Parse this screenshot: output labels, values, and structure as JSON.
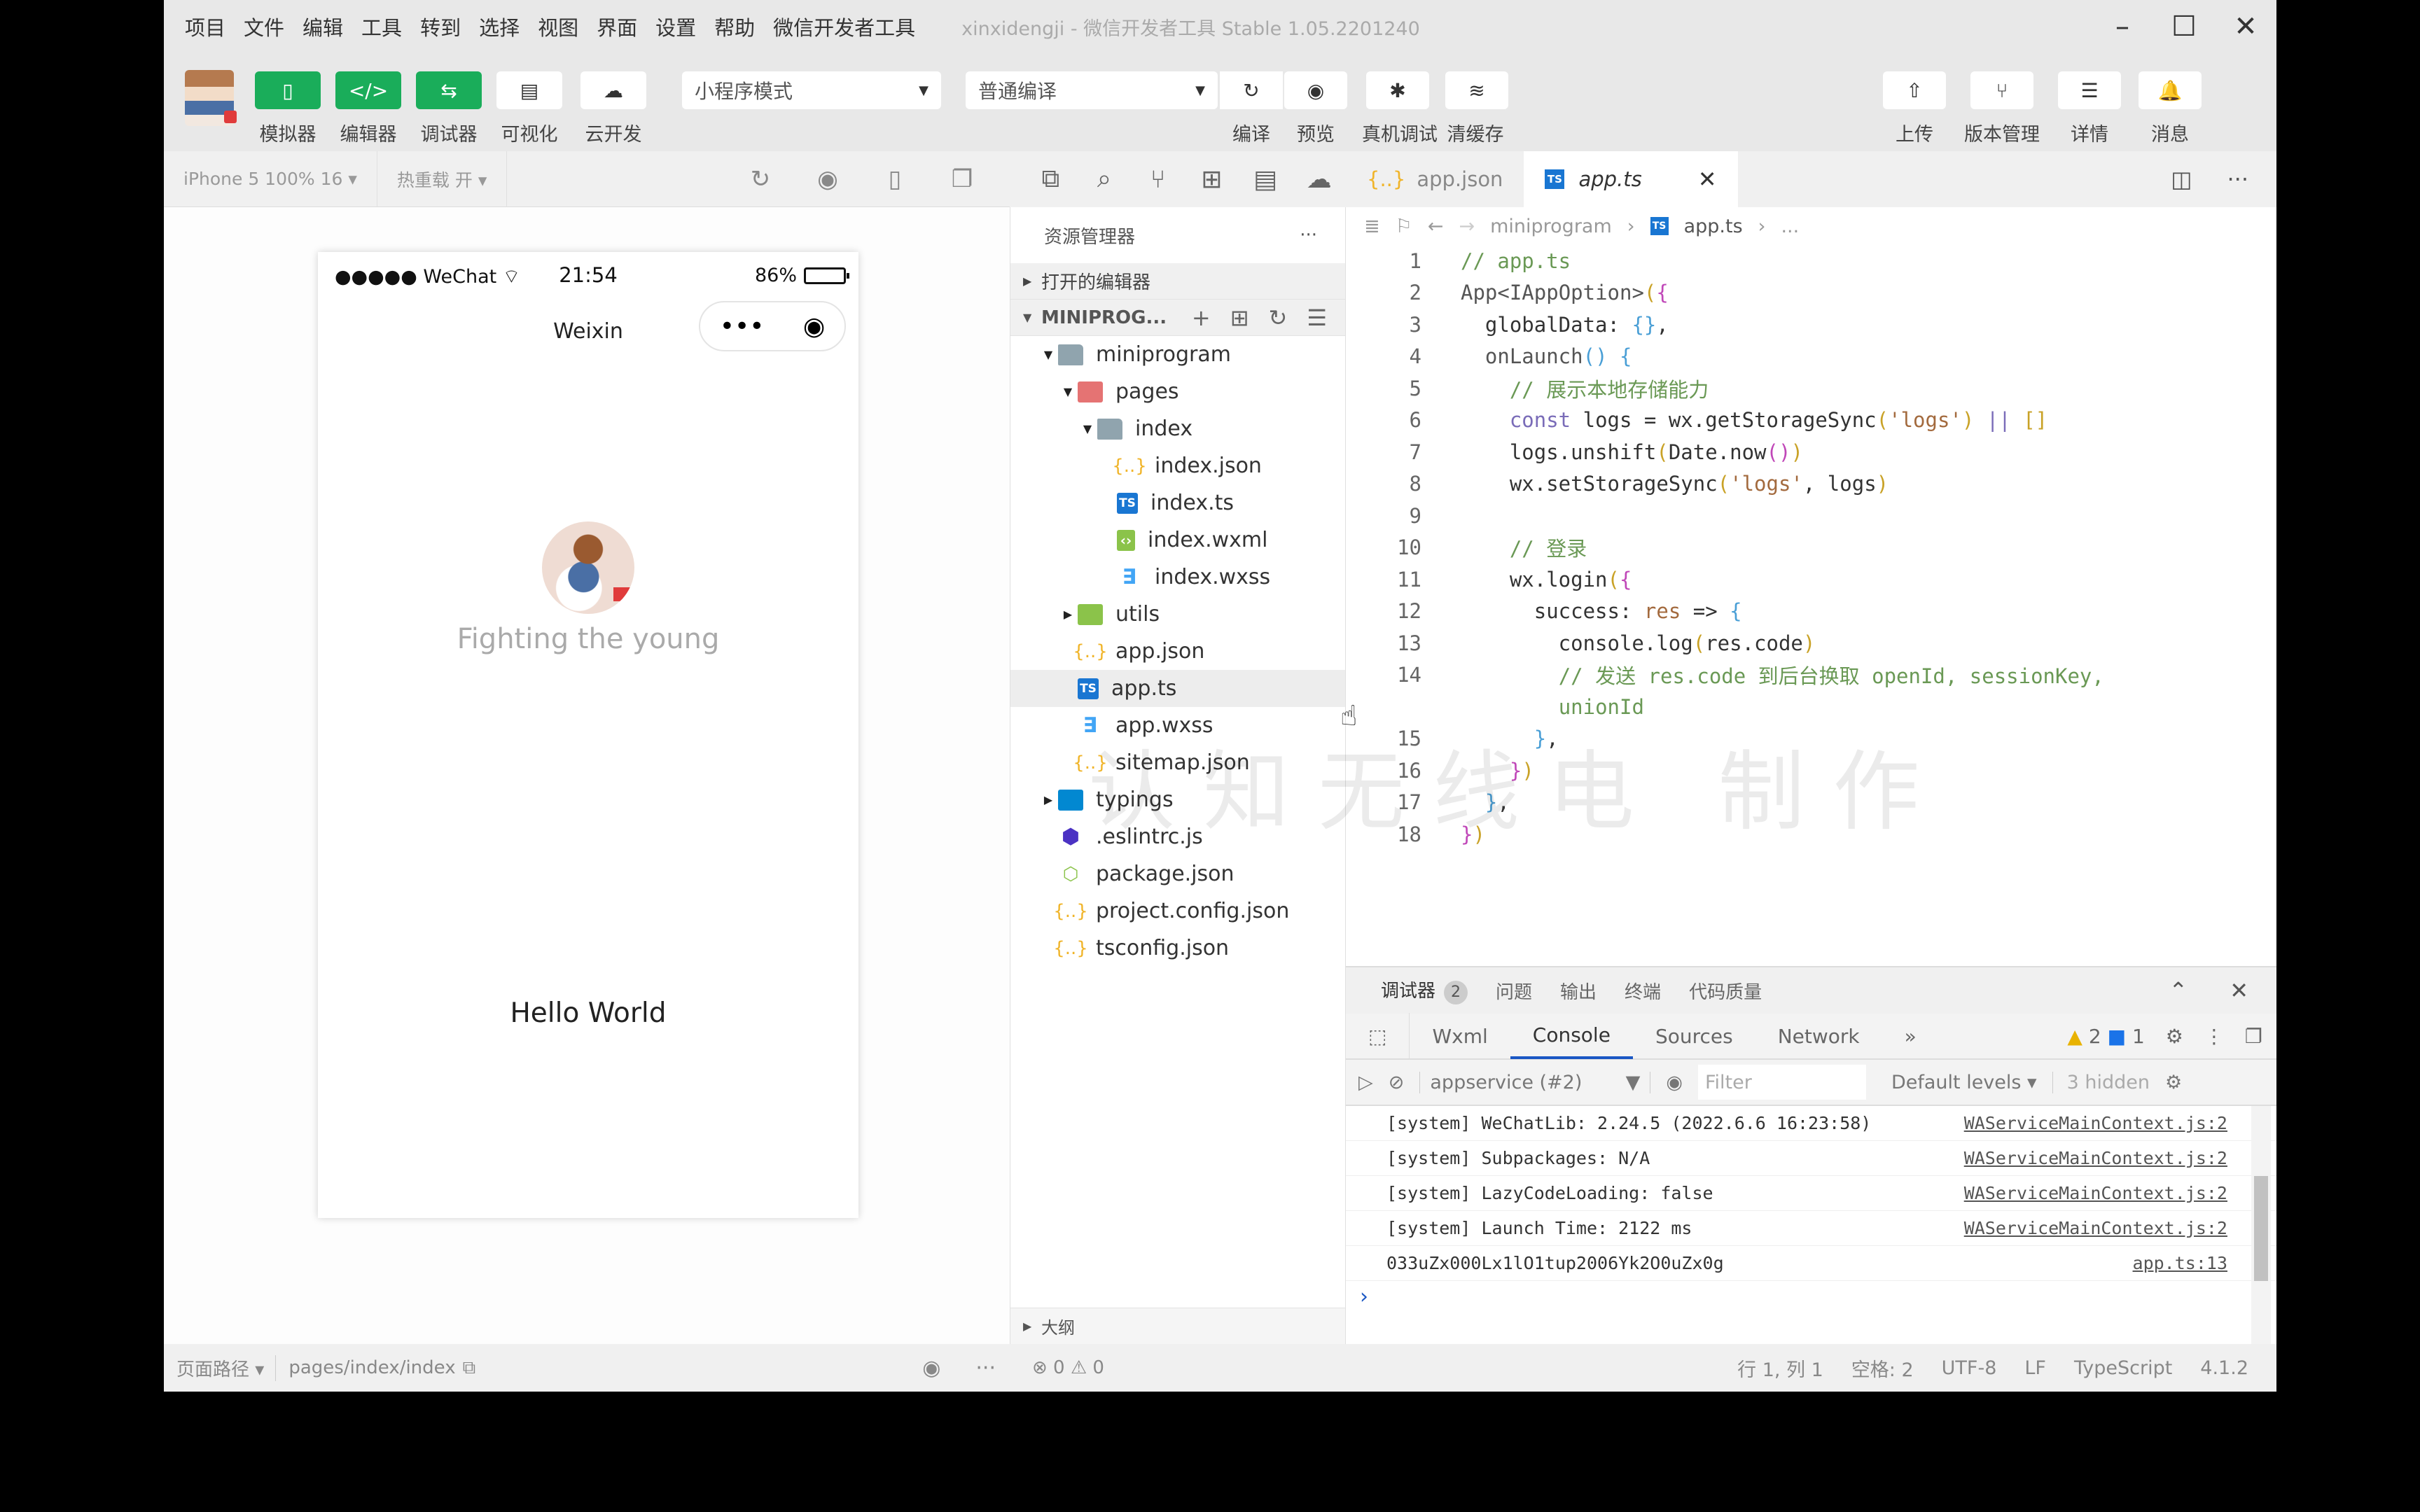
{
  "window": {
    "title": "xinxidengji - 微信开发者工具 Stable 1.05.2201240",
    "controls": {
      "minimize": "–",
      "maximize": "☐",
      "close": "✕"
    }
  },
  "menu": [
    "项目",
    "文件",
    "编辑",
    "工具",
    "转到",
    "选择",
    "视图",
    "界面",
    "设置",
    "帮助",
    "微信开发者工具"
  ],
  "toolbar": {
    "left_buttons": [
      {
        "label": "模拟器",
        "icon": "phone-icon",
        "glyph": "▯",
        "active": true
      },
      {
        "label": "编辑器",
        "icon": "code-icon",
        "glyph": "</>",
        "active": true
      },
      {
        "label": "调试器",
        "icon": "debug-swap-icon",
        "glyph": "⇆",
        "active": true
      },
      {
        "label": "可视化",
        "icon": "layout-icon",
        "glyph": "▤",
        "active": false
      },
      {
        "label": "云开发",
        "icon": "cloud-icon",
        "glyph": "☁",
        "active": false
      }
    ],
    "mode_select": "小程序模式",
    "compile_select": "普通编译",
    "mid_buttons": [
      {
        "label": "编译",
        "icon": "refresh-icon",
        "glyph": "↻"
      },
      {
        "label": "预览",
        "icon": "eye-icon",
        "glyph": "◉"
      },
      {
        "label": "真机调试",
        "icon": "bug-icon",
        "glyph": "✱"
      },
      {
        "label": "清缓存",
        "icon": "layers-icon",
        "glyph": "≋"
      }
    ],
    "right_buttons": [
      {
        "label": "上传",
        "icon": "upload-icon",
        "glyph": "⇧"
      },
      {
        "label": "版本管理",
        "icon": "branch-icon",
        "glyph": "⑂"
      },
      {
        "label": "详情",
        "icon": "menu-icon",
        "glyph": "☰"
      },
      {
        "label": "消息",
        "icon": "bell-icon",
        "glyph": "🔔"
      }
    ]
  },
  "simulator": {
    "device": "iPhone 5 100% 16 ▾",
    "hot_reload": "热重载 开 ▾",
    "phone": {
      "carrier": "●●●●● WeChat",
      "time": "21:54",
      "battery_text": "86%",
      "battery_level": 0.86,
      "nav_title": "Weixin",
      "capsule_more": "•••",
      "capsule_close": "◉",
      "nickname": "Fighting the young",
      "hello": "Hello World"
    },
    "footer": {
      "path_label": "页面路径 ▾",
      "path": "pages/index/index"
    }
  },
  "explorer": {
    "title": "资源管理器",
    "more": "···",
    "open_editors": "打开的编辑器",
    "project": "MINIPROG...",
    "tree": [
      {
        "name": "miniprogram",
        "type": "folder",
        "depth": 0,
        "expanded": true
      },
      {
        "name": "pages",
        "type": "folder-red",
        "depth": 1,
        "expanded": true
      },
      {
        "name": "index",
        "type": "folder",
        "depth": 2,
        "expanded": true
      },
      {
        "name": "index.json",
        "type": "json",
        "depth": 3
      },
      {
        "name": "index.ts",
        "type": "ts",
        "depth": 3
      },
      {
        "name": "index.wxml",
        "type": "wxml",
        "depth": 3
      },
      {
        "name": "index.wxss",
        "type": "wxss",
        "depth": 3
      },
      {
        "name": "utils",
        "type": "folder-green",
        "depth": 1,
        "expanded": false
      },
      {
        "name": "app.json",
        "type": "json",
        "depth": 1
      },
      {
        "name": "app.ts",
        "type": "ts",
        "depth": 1,
        "selected": true
      },
      {
        "name": "app.wxss",
        "type": "wxss",
        "depth": 1
      },
      {
        "name": "sitemap.json",
        "type": "json",
        "depth": 1
      },
      {
        "name": "typings",
        "type": "folder-blue",
        "depth": 0,
        "expanded": false
      },
      {
        "name": ".eslintrc.js",
        "type": "eslint",
        "depth": 0
      },
      {
        "name": "package.json",
        "type": "npm",
        "depth": 0
      },
      {
        "name": "project.config.json",
        "type": "json",
        "depth": 0
      },
      {
        "name": "tsconfig.json",
        "type": "json",
        "depth": 0
      }
    ],
    "outline": "大纲",
    "problems": "⊗ 0 ⚠ 0"
  },
  "editor": {
    "tabs": [
      {
        "label": "app.json",
        "type": "json",
        "active": false
      },
      {
        "label": "app.ts",
        "type": "ts",
        "active": true
      }
    ],
    "breadcrumb": [
      "miniprogram",
      "app.ts",
      "..."
    ],
    "lines": [
      {
        "n": "1",
        "html": "<span class='c-cm'>// app.ts</span>"
      },
      {
        "n": "2",
        "html": "<span class='c-fn'>App</span><span class='c-fn'>&lt;IAppOption&gt;</span><span class='c-br1'>(</span><span class='c-br2'>{</span>"
      },
      {
        "n": "3",
        "html": "  <span class='c-prop'>globalData</span>: <span class='c-br3'>{}</span>,"
      },
      {
        "n": "4",
        "html": "  <span class='c-fn'>onLaunch</span><span class='c-br3'>()</span> <span class='c-br3'>{</span>"
      },
      {
        "n": "5",
        "html": "    <span class='c-cm'>// 展示本地存储能力</span>"
      },
      {
        "n": "6",
        "html": "    <span class='c-kw'>const</span> logs = wx.getStorageSync<span class='c-br1'>(</span><span class='c-str'>'logs'</span><span class='c-br1'>)</span> <span class='c-kw'>||</span> <span class='c-br1'>[]</span>"
      },
      {
        "n": "7",
        "html": "    logs.unshift<span class='c-br1'>(</span>Date.now<span class='c-br2'>()</span><span class='c-br1'>)</span>"
      },
      {
        "n": "8",
        "html": "    wx.setStorageSync<span class='c-br1'>(</span><span class='c-str'>'logs'</span>, logs<span class='c-br1'>)</span>"
      },
      {
        "n": "9",
        "html": ""
      },
      {
        "n": "10",
        "html": "    <span class='c-cm'>// 登录</span>"
      },
      {
        "n": "11",
        "html": "    wx.login<span class='c-br1'>(</span><span class='c-br2'>{</span>"
      },
      {
        "n": "12",
        "html": "      success: <span class='c-str'>res</span> =&gt; <span class='c-br3'>{</span>"
      },
      {
        "n": "13",
        "html": "        console.log<span class='c-br1'>(</span>res.code<span class='c-br1'>)</span>"
      },
      {
        "n": "14",
        "html": "        <span class='c-cm'>// 发送 res.code 到后台换取 openId, sessionKey,</span>"
      },
      {
        "n": "",
        "html": "        <span class='c-cm'>unionId</span>"
      },
      {
        "n": "15",
        "html": "      <span class='c-br3'>}</span>,"
      },
      {
        "n": "16",
        "html": "    <span class='c-br2'>}</span><span class='c-br1'>)</span>"
      },
      {
        "n": "17",
        "html": "  <span class='c-br3'>}</span>,"
      },
      {
        "n": "18",
        "html": "<span class='c-br2'>}</span><span class='c-br1'>)</span>"
      }
    ]
  },
  "debug": {
    "panel_tabs": [
      {
        "label": "调试器",
        "badge": "2"
      },
      {
        "label": "问题"
      },
      {
        "label": "输出"
      },
      {
        "label": "终端"
      },
      {
        "label": "代码质量"
      }
    ],
    "devtools_tabs": [
      "Wxml",
      "Console",
      "Sources",
      "Network",
      "»"
    ],
    "active_devtools_tab": "Console",
    "warnings": "2",
    "infos": "1",
    "context": "appservice (#2)",
    "filter_placeholder": "Filter",
    "levels": "Default levels ▾",
    "hidden": "3 hidden",
    "logs": [
      {
        "msg": "[system] WeChatLib: 2.24.5 (2022.6.6 16:23:58)",
        "src": "WAServiceMainContext.js:2"
      },
      {
        "msg": "[system] Subpackages: N/A",
        "src": "WAServiceMainContext.js:2"
      },
      {
        "msg": "[system] LazyCodeLoading: false",
        "src": "WAServiceMainContext.js:2"
      },
      {
        "msg": "[system] Launch Time: 2122 ms",
        "src": "WAServiceMainContext.js:2"
      },
      {
        "msg": "033uZx000Lx1lO1tup2006Yk2O0uZx0g",
        "src": "app.ts:13"
      }
    ],
    "prompt": "›"
  },
  "statusbar": {
    "position": "行 1, 列 1",
    "spaces": "空格: 2",
    "encoding": "UTF-8",
    "eol": "LF",
    "language": "TypeScript",
    "version": "4.1.2"
  },
  "watermark": "认知无线电 制作"
}
